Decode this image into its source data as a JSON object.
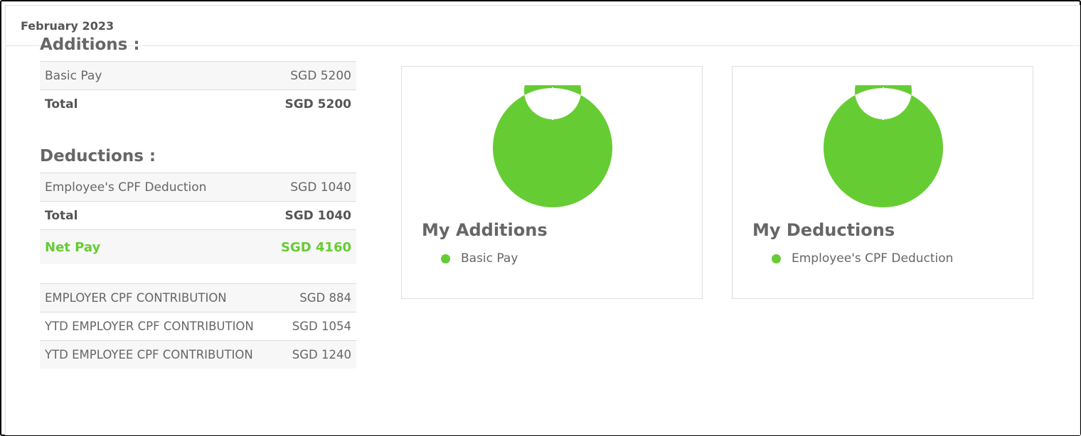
{
  "header": {
    "title": "February 2023"
  },
  "additions": {
    "heading": "Additions :",
    "items": [
      {
        "label": "Basic Pay",
        "value": "SGD 5200"
      }
    ],
    "total": {
      "label": "Total",
      "value": "SGD 5200"
    }
  },
  "deductions": {
    "heading": "Deductions :",
    "items": [
      {
        "label": "Employee's CPF Deduction",
        "value": "SGD 1040"
      }
    ],
    "total": {
      "label": "Total",
      "value": "SGD 1040"
    }
  },
  "net_pay": {
    "label": "Net Pay",
    "value": "SGD 4160"
  },
  "contributions": [
    {
      "label": "EMPLOYER CPF CONTRIBUTION",
      "value": "SGD 884"
    },
    {
      "label": "YTD EMPLOYER CPF CONTRIBUTION",
      "value": "SGD 1054"
    },
    {
      "label": "YTD EMPLOYEE CPF CONTRIBUTION",
      "value": "SGD 1240"
    }
  ],
  "colors": {
    "accent": "#66cc33",
    "text": "#666666"
  },
  "chart_data": [
    {
      "type": "pie",
      "title": "My Additions",
      "categories": [
        "Basic Pay"
      ],
      "values": [
        5200
      ],
      "legend": "bottom"
    },
    {
      "type": "pie",
      "title": "My Deductions",
      "categories": [
        "Employee's CPF Deduction"
      ],
      "values": [
        1040
      ],
      "legend": "bottom"
    }
  ]
}
